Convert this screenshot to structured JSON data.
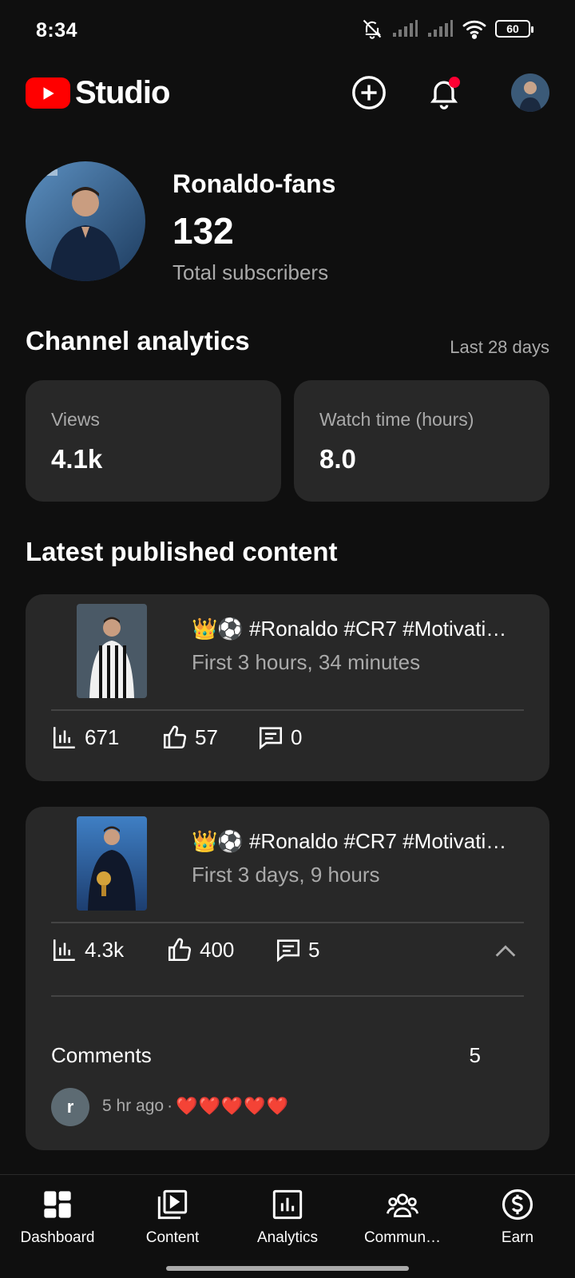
{
  "status_bar": {
    "time": "8:34",
    "battery": "60"
  },
  "app": {
    "logo_text": "Studio"
  },
  "channel": {
    "name": "Ronaldo-fans",
    "subscribers": "132",
    "subscribers_label": "Total subscribers"
  },
  "analytics": {
    "title": "Channel analytics",
    "period": "Last 28 days",
    "metrics": [
      {
        "label": "Views",
        "value": "4.1k"
      },
      {
        "label": "Watch time (hours)",
        "value": "8.0"
      }
    ]
  },
  "latest": {
    "title": "Latest published content",
    "videos": [
      {
        "title": "👑⚽ #Ronaldo #CR7 #Motivati…",
        "subtitle": "First 3 hours, 34 minutes",
        "views": "671",
        "likes": "57",
        "comments": "0"
      },
      {
        "title": "👑⚽ #Ronaldo #CR7 #Motivati…",
        "subtitle": "First 3 days, 9 hours",
        "views": "4.3k",
        "likes": "400",
        "comments": "5",
        "comments_section": {
          "label": "Comments",
          "count": "5",
          "avatar_letter": "r",
          "time": "5 hr ago",
          "separator": "·",
          "text": "❤️❤️❤️❤️❤️"
        }
      }
    ]
  },
  "nav": {
    "items": [
      {
        "label": "Dashboard",
        "icon": "dashboard-icon"
      },
      {
        "label": "Content",
        "icon": "content-icon"
      },
      {
        "label": "Analytics",
        "icon": "analytics-icon"
      },
      {
        "label": "Commun…",
        "icon": "community-icon"
      },
      {
        "label": "Earn",
        "icon": "earn-icon"
      }
    ]
  },
  "colors": {
    "brand": "#ff0000",
    "card": "#282828",
    "background": "#0f0f0f",
    "notification_dot": "#ff0033"
  }
}
